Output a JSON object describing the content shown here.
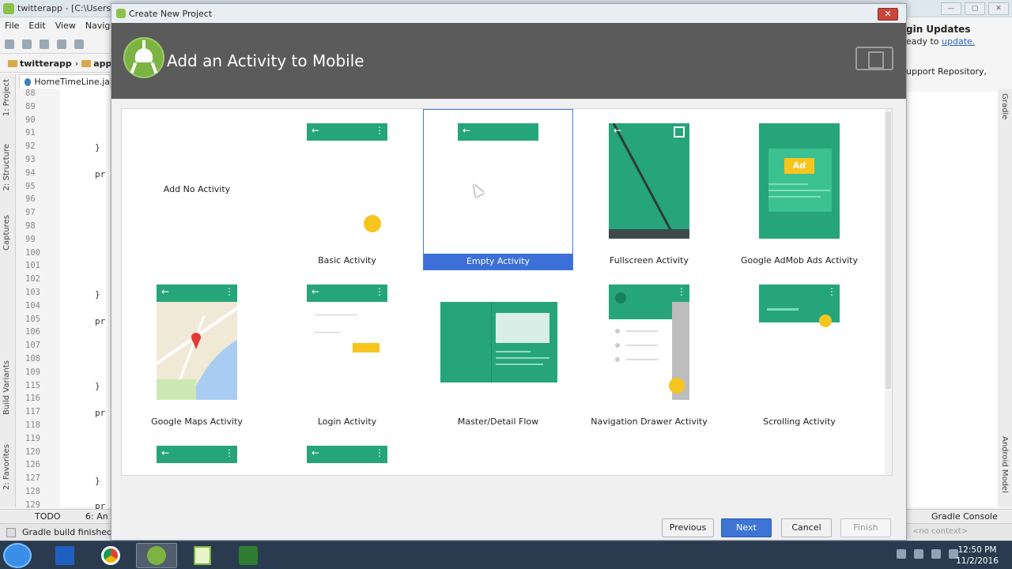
{
  "ide": {
    "title": "twitterapp - [C:\\Users\\",
    "menu": [
      "File",
      "Edit",
      "View",
      "Naviga"
    ],
    "breadcrumbs": [
      "twitterapp",
      "app"
    ],
    "file_tab": "HomeTimeLine.ja",
    "left_tool_windows": [
      "1: Project",
      "2: Structure",
      "Captures",
      "Build Variants",
      "2: Favorites"
    ],
    "line_numbers": [
      "88",
      "89",
      "90",
      "91",
      "92",
      "93",
      "94",
      "95",
      "96",
      "97",
      "98",
      "99",
      "100",
      "101",
      "102",
      "103",
      "104",
      "105",
      "106",
      "107",
      "108",
      "109",
      "115",
      "116",
      "117",
      "118",
      "119",
      "120",
      "126",
      "127",
      "128",
      "129"
    ],
    "code_fragments": [
      "}",
      "pr",
      "}",
      "pr",
      "}",
      "pr",
      "}",
      "pr"
    ],
    "right_panel": {
      "title": "gin Updates",
      "ready_prefix": "eady to ",
      "ready_link": "update.",
      "repo_text": "upport Repository,"
    },
    "right_tool_windows": [
      "Gradle",
      "Android Model"
    ],
    "bottom_tabs": {
      "todo": "TODO",
      "android": "6: An",
      "gradle_console": "Gradle Console"
    },
    "status_text": "Gradle build finished",
    "context": "<no context>"
  },
  "dialog": {
    "window_title": "Create New Project",
    "close_label": "✕",
    "heading": "Add an Activity to Mobile",
    "activities": [
      {
        "label": "Add No Activity"
      },
      {
        "label": "Basic Activity"
      },
      {
        "label": "Empty Activity",
        "selected": true
      },
      {
        "label": "Fullscreen Activity"
      },
      {
        "label": "Google AdMob Ads Activity",
        "ad_badge": "Ad"
      },
      {
        "label": "Google Maps Activity"
      },
      {
        "label": "Login Activity"
      },
      {
        "label": "Master/Detail Flow"
      },
      {
        "label": "Navigation Drawer Activity"
      },
      {
        "label": "Scrolling Activity"
      }
    ],
    "buttons": {
      "previous": "Previous",
      "next": "Next",
      "cancel": "Cancel",
      "finish": "Finish"
    }
  },
  "taskbar": {
    "time": "12:50 PM",
    "date": "11/2/2016"
  },
  "colors": {
    "accent_green": "#26a57a",
    "fab_yellow": "#f7c51e",
    "selection_blue": "#3d6fd8",
    "header_gray": "#5b5b5b"
  }
}
